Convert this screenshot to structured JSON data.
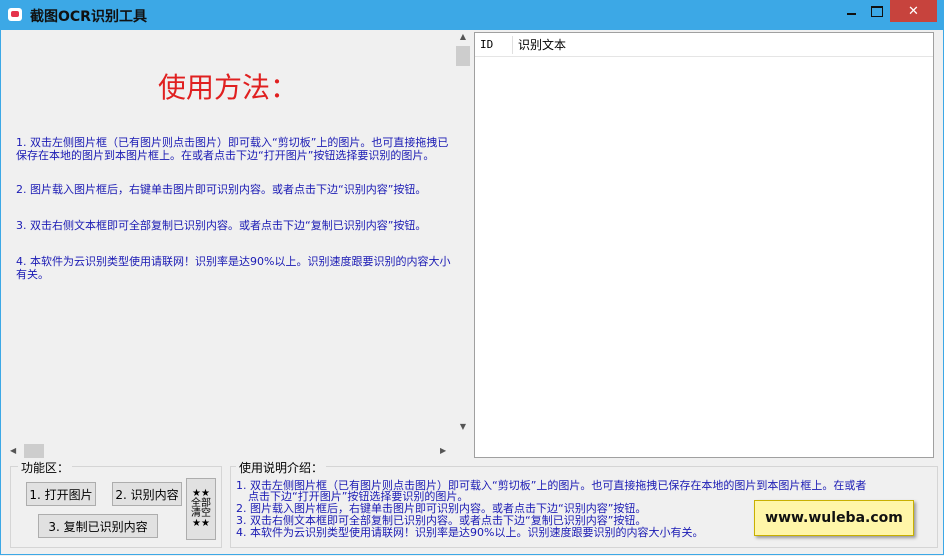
{
  "window": {
    "title": "截图OCR识别工具",
    "min_symbol": "",
    "close_symbol": "✕"
  },
  "left_pane": {
    "usage_title": "使用方法：",
    "tips": [
      "1. 双击左侧图片框（已有图片则点击图片）即可载入“剪切板”上的图片。也可直接拖拽已保存在本地的图片到本图片框上。在或者点击下边“打开图片”按钮选择要识别的图片。",
      "2. 图片载入图片框后，右键单击图片即可识别内容。或者点击下边“识别内容”按钮。",
      "3. 双击右侧文本框即可全部复制已识别内容。或者点击下边“复制已识别内容”按钮。",
      "4. 本软件为云识别类型使用请联网！识别率是达90%以上。识别速度跟要识别的内容大小有关。"
    ]
  },
  "list": {
    "col_id": "ID",
    "col_text": "识别文本"
  },
  "func_area": {
    "label": "功能区：",
    "open_btn": "1. 打开图片",
    "recognize_btn": "2. 识别内容",
    "copy_btn": "3. 复制已识别内容",
    "clear_btn": [
      "★★",
      "全部",
      "清空",
      "★★"
    ]
  },
  "instructions": {
    "label": "使用说明介绍：",
    "lines": [
      "1. 双击左侧图片框（已有图片则点击图片）即可载入“剪切板”上的图片。也可直接拖拽已保存在本地的图片到本图片框上。在或者",
      "点击下边“打开图片”按钮选择要识别的图片。",
      "2. 图片载入图片框后，右键单击图片即可识别内容。或者点击下边“识别内容”按钮。",
      "3. 双击右侧文本框即可全部复制已识别内容。或者点击下边“复制已识别内容”按钮。",
      "4. 本软件为云识别类型使用请联网！识别率是达90%以上。识别速度跟要识别的内容大小有关。"
    ]
  },
  "watermark": "www.wuleba.com",
  "colors": {
    "titlebar": "#3ca8e6",
    "tip_text": "#1a1ab4",
    "usage_title": "#e02020",
    "close_button": "#c7433d"
  }
}
